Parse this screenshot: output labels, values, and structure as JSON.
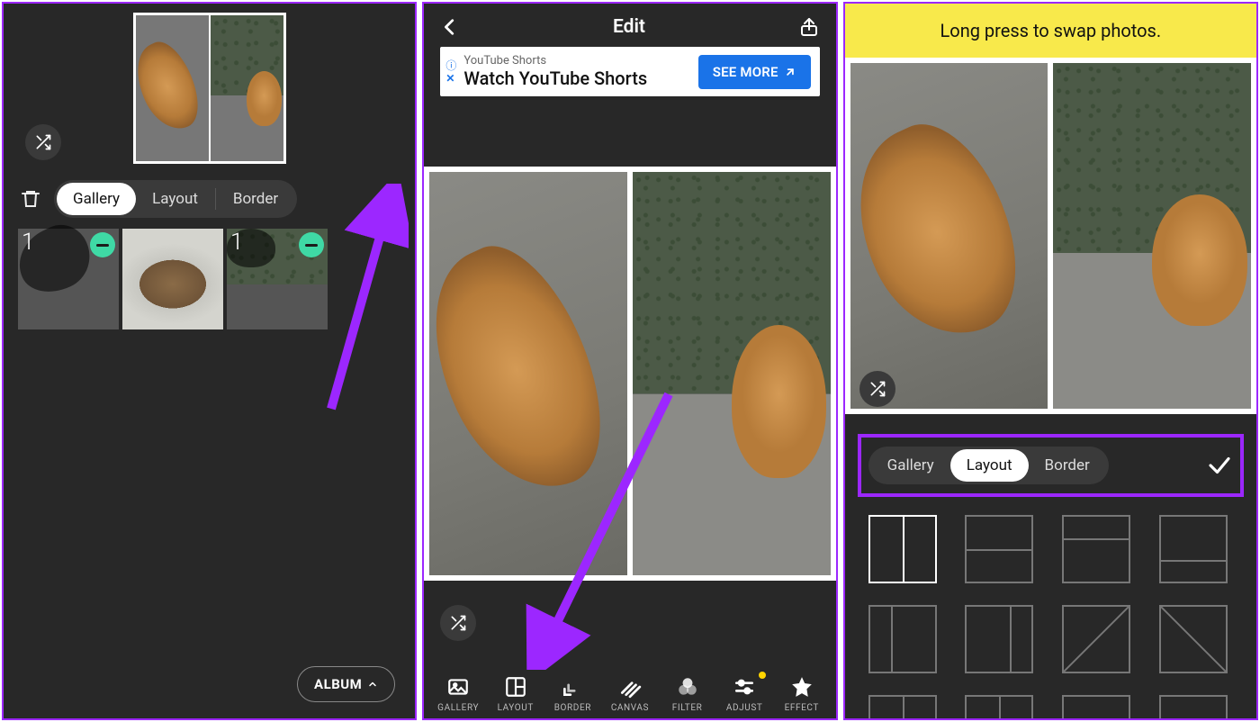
{
  "panel1": {
    "segments": {
      "gallery": "Gallery",
      "layout": "Layout",
      "border": "Border"
    },
    "thumbs": [
      {
        "num": "1",
        "kind": "cat-lying",
        "dim": true,
        "minus": true
      },
      {
        "num": "",
        "kind": "bowl",
        "dim": false,
        "minus": false
      },
      {
        "num": "1",
        "kind": "cat-peek",
        "dim": true,
        "minus": true
      }
    ],
    "album_label": "ALBUM"
  },
  "panel2": {
    "title": "Edit",
    "ad": {
      "small": "YouTube Shorts",
      "big": "Watch YouTube Shorts",
      "cta": "SEE MORE"
    },
    "tools": [
      {
        "key": "gallery",
        "label": "GALLERY"
      },
      {
        "key": "layout",
        "label": "LAYOUT"
      },
      {
        "key": "border",
        "label": "BORDER"
      },
      {
        "key": "canvas",
        "label": "CANVAS"
      },
      {
        "key": "filter",
        "label": "FILTER"
      },
      {
        "key": "adjust",
        "label": "ADJUST"
      },
      {
        "key": "effect",
        "label": "EFFECT"
      }
    ]
  },
  "panel3": {
    "banner": "Long press to swap photos.",
    "segments": {
      "gallery": "Gallery",
      "layout": "Layout",
      "border": "Border"
    }
  }
}
